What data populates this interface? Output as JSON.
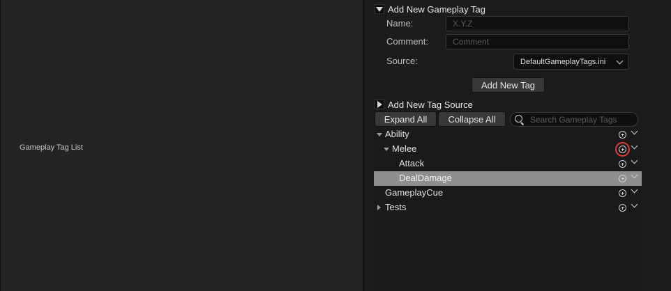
{
  "left_panel": {
    "label": "Gameplay Tag List"
  },
  "add_tag": {
    "title": "Add New Gameplay Tag",
    "name_label": "Name:",
    "name_placeholder": "X.Y.Z",
    "comment_label": "Comment:",
    "comment_placeholder": "Comment",
    "source_label": "Source:",
    "source_value": "DefaultGameplayTags.ini",
    "add_button": "Add New Tag"
  },
  "add_source": {
    "title": "Add New Tag Source"
  },
  "toolbar": {
    "expand_all": "Expand All",
    "collapse_all": "Collapse All",
    "search_placeholder": "Search Gameplay Tags"
  },
  "tree": {
    "rows": [
      {
        "label": "Ability",
        "expander": "expanded"
      },
      {
        "label": "Melee",
        "expander": "expanded"
      },
      {
        "label": "Attack",
        "expander": "none"
      },
      {
        "label": "DealDamage",
        "expander": "none",
        "selected": true
      },
      {
        "label": "GameplayCue",
        "expander": "none"
      },
      {
        "label": "Tests",
        "expander": "collapsed"
      }
    ]
  },
  "colors": {
    "panel_bg": "#242424",
    "tree_bg": "#1a1a1a",
    "selected_row": "#8f8f8f",
    "highlight_outline": "#e23a3a"
  },
  "icons": [
    "triangle-down-icon",
    "triangle-right-icon",
    "search-icon",
    "add-subtag-icon",
    "chevron-down-icon"
  ]
}
